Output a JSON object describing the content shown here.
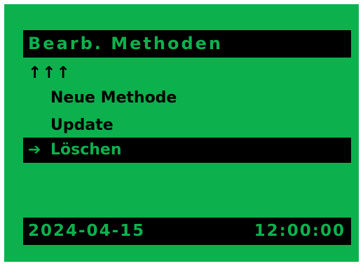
{
  "screen": {
    "title": "Bearb. Methoden",
    "scroll_up_indicator": "↑↑↑",
    "menu": {
      "cursor_icon": "➔",
      "items": [
        {
          "label": "Neue Methode",
          "selected": false
        },
        {
          "label": "Update",
          "selected": false
        },
        {
          "label": "Löschen",
          "selected": true
        }
      ]
    },
    "status": {
      "date": "2024-04-15",
      "time": "12:00:00"
    }
  },
  "colors": {
    "background": "#0cb14e",
    "highlight": "#000000"
  },
  "icons": {
    "scroll_up": "up-arrow-icon",
    "cursor": "right-arrow-icon"
  }
}
